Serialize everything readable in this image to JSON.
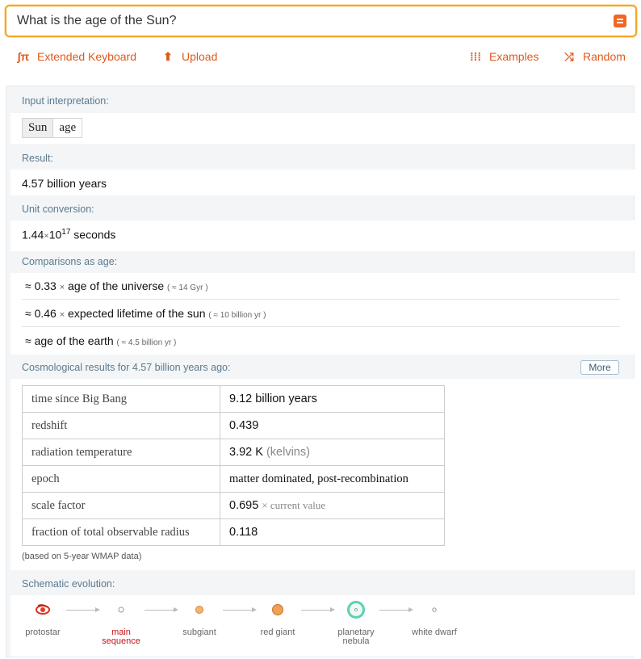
{
  "search": {
    "query": "What is the age of the Sun?"
  },
  "toolbar": {
    "keyboard_label": "Extended Keyboard",
    "upload_label": "Upload",
    "examples_label": "Examples",
    "random_label": "Random"
  },
  "pods": {
    "interpretation": {
      "title": "Input interpretation:",
      "key": "Sun",
      "value": "age"
    },
    "result": {
      "title": "Result:",
      "value": "4.57 billion years"
    },
    "unit_conversion": {
      "title": "Unit conversion:",
      "mantissa": "1.44",
      "times": "×",
      "base": "10",
      "exponent": "17",
      "unit": "seconds"
    },
    "comparisons": {
      "title": "Comparisons as age:",
      "rows": [
        {
          "prefix": "≈ 0.33",
          "times": "×",
          "text": "age of the universe",
          "note": "( ≈ 14 Gyr )"
        },
        {
          "prefix": "≈ 0.46",
          "times": "×",
          "text": "expected lifetime of the sun",
          "note": "( ≈ 10 billion yr )"
        },
        {
          "prefix": "≈",
          "times": "",
          "text": "age of the earth",
          "note": "( ≈ 4.5 billion yr )"
        }
      ]
    },
    "cosmological": {
      "title": "Cosmological results for 4.57 billion years ago:",
      "more_label": "More",
      "rows": [
        {
          "label": "time since Big Bang",
          "value": "9.12 billion years",
          "extra": ""
        },
        {
          "label": "redshift",
          "value": "0.439",
          "extra": ""
        },
        {
          "label": "radiation temperature",
          "value": "3.92 K",
          "extra": "(kelvins)"
        },
        {
          "label": "epoch",
          "value": "matter dominated, post-recombination",
          "extra": ""
        },
        {
          "label": "scale factor",
          "value": "0.695",
          "extra": "× current value"
        },
        {
          "label": "fraction of total observable radius",
          "value": "0.118",
          "extra": ""
        }
      ],
      "note": "(based on 5-year WMAP data)"
    },
    "evolution": {
      "title": "Schematic evolution:",
      "stages": [
        {
          "name": "protostar",
          "icon": "protostar-icon",
          "active": false
        },
        {
          "name": "main sequence",
          "icon": "main-sequence-star-icon",
          "active": true
        },
        {
          "name": "subgiant",
          "icon": "subgiant-star-icon",
          "active": false
        },
        {
          "name": "red giant",
          "icon": "red-giant-star-icon",
          "active": false
        },
        {
          "name": "planetary nebula",
          "icon": "planetary-nebula-icon",
          "active": false
        },
        {
          "name": "white dwarf",
          "icon": "white-dwarf-icon",
          "active": false
        }
      ]
    }
  },
  "colors": {
    "accent": "#dd5a1c",
    "search_border": "#f5a623",
    "header_text": "#5b7a8f",
    "active_stage": "#c4161c"
  }
}
